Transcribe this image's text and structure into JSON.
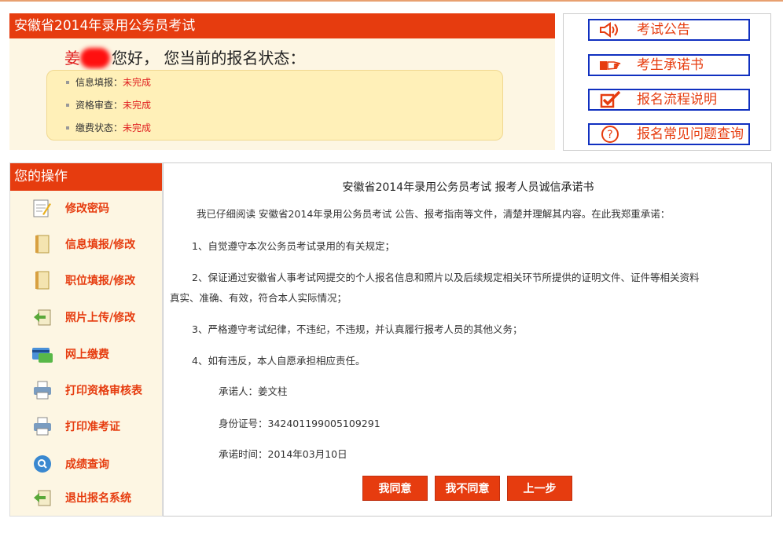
{
  "status_panel": {
    "title": "安徽省2014年录用公务员考试",
    "greeting_surname": "姜",
    "greeting_rest": "您好， 您当前的报名状态：",
    "items": [
      {
        "label": "信息填报",
        "sep": "：",
        "value": "未完成"
      },
      {
        "label": "资格审查",
        "sep": "：",
        "value": "未完成"
      },
      {
        "label": "缴费状态",
        "sep": "：",
        "value": "未完成"
      }
    ]
  },
  "quick_links": [
    {
      "label": "考试公告",
      "icon": "speaker-icon"
    },
    {
      "label": "考生承诺书",
      "icon": "pointing-hand-icon"
    },
    {
      "label": "报名流程说明",
      "icon": "checkbox-icon"
    },
    {
      "label": "报名常见问题查询",
      "icon": "question-icon"
    }
  ],
  "menu": {
    "title": "您的操作",
    "items": [
      {
        "label": "修改密码",
        "icon": "notepad-pencil-icon"
      },
      {
        "label": "信息填报/修改",
        "icon": "book-icon"
      },
      {
        "label": "职位填报/修改",
        "icon": "book-icon"
      },
      {
        "label": "照片上传/修改",
        "icon": "arrow-left-icon"
      },
      {
        "label": "网上缴费",
        "icon": "card-icon"
      },
      {
        "label": "打印资格审核表",
        "icon": "printer-icon"
      },
      {
        "label": "打印准考证",
        "icon": "printer-icon"
      },
      {
        "label": "成绩查询",
        "icon": "magnifier-icon"
      },
      {
        "label": "退出报名系统",
        "icon": "exit-icon"
      }
    ]
  },
  "pledge": {
    "title": "安徽省2014年录用公务员考试 报考人员诚信承诺书",
    "intro": "我已仔细阅读 安徽省2014年录用公务员考试 公告、报考指南等文件，清楚并理解其内容。在此我郑重承诺：",
    "p1": "1、自觉遵守本次公务员考试录用的有关规定；",
    "p2a": "2、保证通过安徽省人事考试网提交的个人报名信息和照片以及后续规定相关环节所提供的证明文件、证件等相关资料",
    "p2b": "真实、准确、有效，符合本人实际情况；",
    "p3": "3、严格遵守考试纪律，不违纪，不违规，并认真履行报考人员的其他义务；",
    "p4": "4、如有违反，本人自愿承担相应责任。",
    "signer": "承诺人：姜文柱",
    "id_number": "身份证号：342401199005109291",
    "date": "承诺时间：2014年03月10日"
  },
  "buttons": {
    "agree": "我同意",
    "disagree": "我不同意",
    "back": "上一步"
  },
  "colors": {
    "accent": "#e63c0f",
    "link_border": "#1030c0",
    "status_bg": "#fff0b8"
  }
}
